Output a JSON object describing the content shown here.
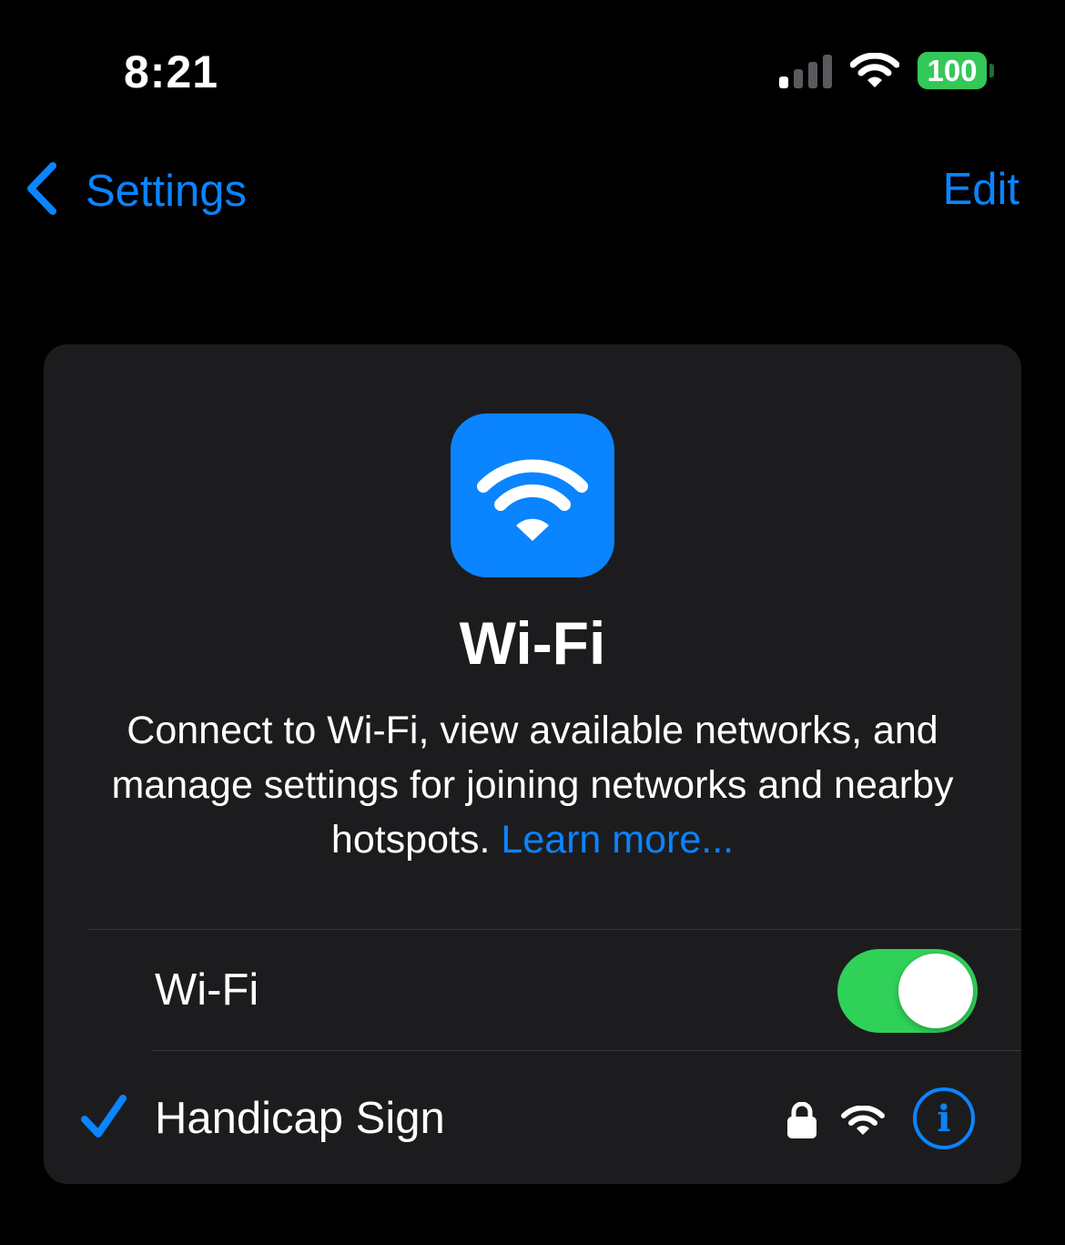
{
  "status_bar": {
    "time": "8:21",
    "battery": "100",
    "icons": [
      "signal-icon",
      "wifi-icon",
      "battery-icon"
    ],
    "battery_color": "#34c759"
  },
  "nav": {
    "back_label": "Settings",
    "edit_label": "Edit",
    "accent_color": "#0a84ff"
  },
  "card": {
    "icon": "wifi-icon",
    "title": "Wi-Fi",
    "description": "Connect to Wi-Fi, view available networks, and manage settings for joining networks and nearby hotspots. ",
    "learn_more": "Learn more..."
  },
  "wifi_toggle": {
    "label": "Wi-Fi",
    "on": true,
    "color": "#30d158"
  },
  "connected_network": {
    "name": "Handicap Sign",
    "connected": true,
    "secured": true,
    "icons": [
      "checkmark-icon",
      "lock-icon",
      "wifi-icon",
      "info-icon"
    ],
    "info_glyph": "i"
  }
}
